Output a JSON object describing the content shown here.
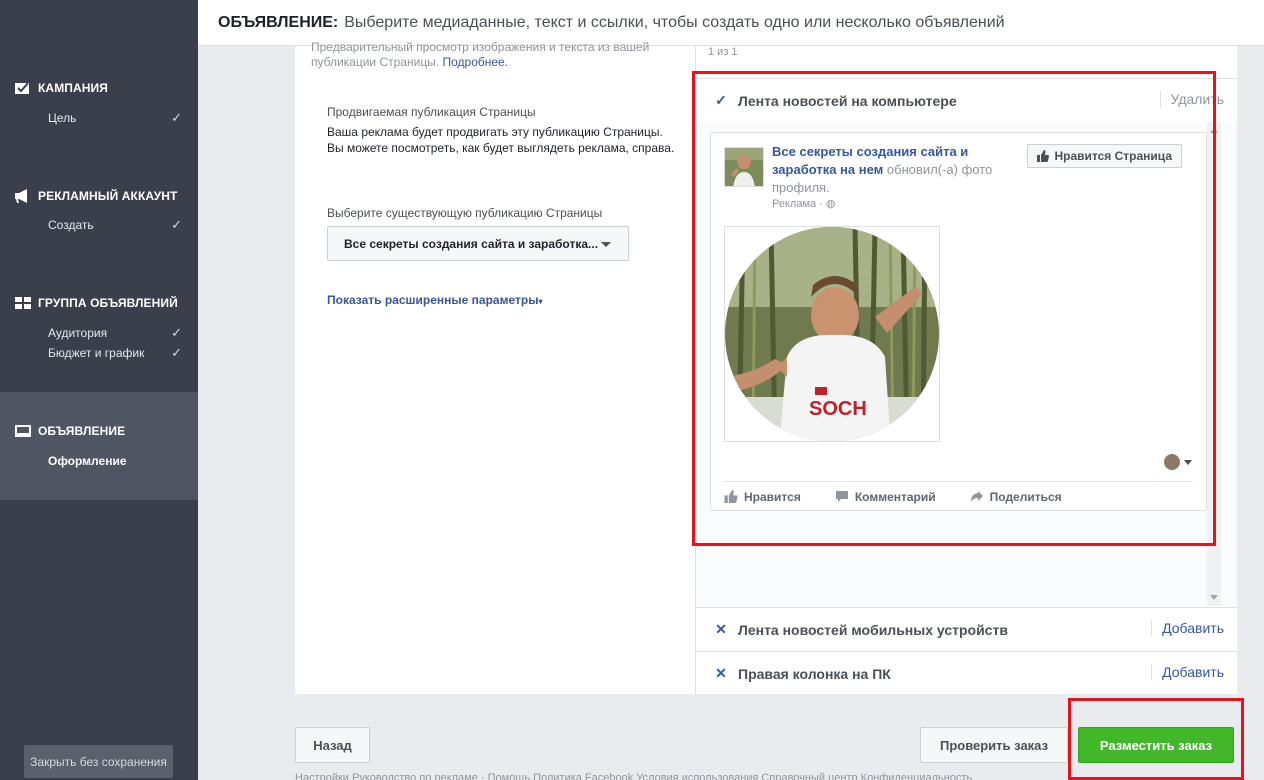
{
  "header": {
    "section": "ОБЪЯВЛЕНИЕ:",
    "subtitle": "Выберите медиаданные, текст и ссылки, чтобы создать одно или несколько объявлений"
  },
  "sidebar": {
    "sections": [
      {
        "title": "КАМПАНИЯ",
        "icon": "checkbox-icon",
        "items": [
          {
            "label": "Цель",
            "done": true
          }
        ]
      },
      {
        "title": "РЕКЛАМНЫЙ АККАУНТ",
        "icon": "megaphone-icon",
        "items": [
          {
            "label": "Создать",
            "done": true
          }
        ]
      },
      {
        "title": "ГРУППА ОБЪЯВЛЕНИЙ",
        "icon": "grid-icon",
        "items": [
          {
            "label": "Аудитория",
            "done": true
          },
          {
            "label": "Бюджет и график",
            "done": true
          }
        ]
      },
      {
        "title": "ОБЪЯВЛЕНИЕ",
        "icon": "monitor-icon",
        "items": [
          {
            "label": "Оформление",
            "done": false
          }
        ],
        "active": true
      }
    ],
    "close_label": "Закрыть без сохранения"
  },
  "form": {
    "cut_text_1": "Предварительный просмотр изображения и текста из вашей",
    "cut_text_2": "публикации Страницы.",
    "cut_link": "Подробнее.",
    "promoted_title": "Продвигаемая публикация Страницы",
    "promoted_desc": "Ваша реклама будет продвигать эту публикацию Страницы. Вы можете посмотреть, как будет выглядеть реклама, справа.",
    "select_label": "Выберите существующую публикацию Страницы",
    "select_value": "Все секреты создания сайта и заработка...",
    "advanced_link": "Показать расширенные параметры"
  },
  "preview": {
    "pager": "1 из 1",
    "tabs": [
      {
        "label": "Лента новостей на компьютере",
        "icon": "check-icon",
        "action": "Удалить"
      },
      {
        "label": "Лента новостей мобильных устройств",
        "icon": "x-icon",
        "action": "Добавить"
      },
      {
        "label": "Правая колонка на ПК",
        "icon": "x-icon",
        "action": "Добавить"
      }
    ],
    "post": {
      "page_name": "Все секреты создания сайта и заработка на нем",
      "action_text": "обновил(-а) фото профиля.",
      "meta": "Реклама · ",
      "like_page": "Нравится Страница",
      "like": "Нравится",
      "comment": "Комментарий",
      "share": "Поделиться"
    }
  },
  "buttons": {
    "back": "Назад",
    "review": "Проверить заказ",
    "place": "Разместить заказ"
  },
  "footer_cut": "Настройки     Руководство по рекламе  ·  Помощь     Политика Facebook     Условия использования     Справочный центр     Конфиденциальность",
  "colors": {
    "sidebar": "#3a3f4b",
    "accent_link": "#365899",
    "place_button": "#42b72a",
    "highlight": "#e3141c"
  }
}
